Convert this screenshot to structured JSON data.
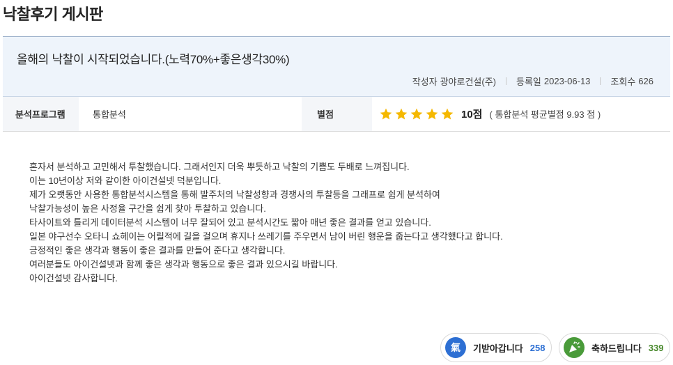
{
  "board": {
    "title": "낙찰후기 게시판"
  },
  "post": {
    "title": "올해의 낙찰이 시작되었습니다.(노력70%+좋은생각30%)",
    "author_label": "작성자",
    "author": "광야로건설(주)",
    "date_label": "등록일",
    "date": "2023-06-13",
    "views_label": "조회수",
    "views": "626"
  },
  "info": {
    "program_label": "분석프로그램",
    "program_value": "통합분석",
    "rating_label": "별점",
    "rating_stars": 5,
    "rating_max": 5,
    "rating_score": "10점",
    "rating_avg": "( 통합분석 평균별점 9.93 점 )",
    "star_color": "#f5b800"
  },
  "body": {
    "lines": [
      "혼자서 분석하고 고민해서 투찰했습니다. 그래서인지 더욱 뿌듯하고 낙찰의 기쁨도 두배로 느껴집니다.",
      "이는 10년이상 저와 같이한 아이건설넷 덕분입니다.",
      "제가 오랫동안 사용한 통합분석시스템을 통해 발주처의 낙찰성향과 경쟁사의 투찰등을 그래프로 쉽게 분석하여",
      "낙찰가능성이 높은 사정율 구간을 쉽게 찾아 투찰하고 있습니다.",
      "타사이트와 틀리게 데이터분석 시스템이 너무 잘되어 있고 분석시간도 짧아 매년 좋은 결과를 얻고 있습니다.",
      "일본 야구선수 오타니 쇼헤이는 어릴적에 길을 걸으며 휴지나 쓰레기를 주우면서 남이 버린 행운을 줍는다고 생각했다고 합니다.",
      "긍정적인 좋은 생각과 행동이 좋은 결과를 만들어 준다고 생각합니다.",
      "여러분들도 아이건설넷과 함께 좋은 생각과 행동으로 좋은 결과 있으시길 바랍니다.",
      "아이건설넷 감사합니다."
    ]
  },
  "reactions": {
    "cheer": {
      "icon": "氣",
      "label": "기받아갑니다",
      "count": "258",
      "color": "#2d6fd3"
    },
    "congrats": {
      "icon": "party-popper-icon",
      "label": "축하드립니다",
      "count": "339",
      "color": "#4a9b3a"
    }
  }
}
